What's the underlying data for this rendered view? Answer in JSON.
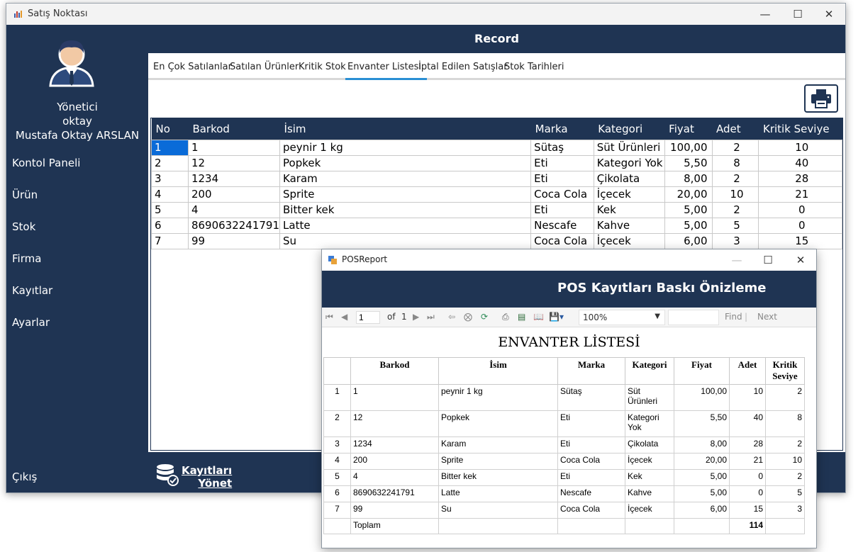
{
  "main_window": {
    "title": "Satış Noktası",
    "header": "Record"
  },
  "user": {
    "role": "Yönetici",
    "username": "oktay",
    "fullname": "Mustafa Oktay ARSLAN"
  },
  "nav": [
    {
      "label": "Kontol Paneli"
    },
    {
      "label": "Ürün"
    },
    {
      "label": "Stok"
    },
    {
      "label": "Firma"
    },
    {
      "label": "Kayıtlar"
    },
    {
      "label": "Ayarlar"
    }
  ],
  "logout": "Çıkış",
  "manage": {
    "line1": "Kayıtları",
    "line2": "Yönet"
  },
  "tabs": [
    {
      "label": "En Çok Satılanlar"
    },
    {
      "label": "Satılan Ürünler"
    },
    {
      "label": "Kritik Stok"
    },
    {
      "label": "Envanter Listesi",
      "active": true
    },
    {
      "label": "İptal Edilen Satışlar"
    },
    {
      "label": "Stok Tarihleri"
    }
  ],
  "grid": {
    "headers": [
      "No",
      "Barkod",
      "İsim",
      "Marka",
      "Kategori",
      "Fiyat",
      "Adet",
      "Kritik Seviye"
    ],
    "rows": [
      [
        "1",
        "1",
        "peynir 1 kg",
        "Sütaş",
        "Süt Ürünleri",
        "100,00",
        "2",
        "10"
      ],
      [
        "2",
        "12",
        "Popkek",
        "Eti",
        "Kategori Yok",
        "5,50",
        "8",
        "40"
      ],
      [
        "3",
        "1234",
        "Karam",
        "Eti",
        "Çikolata",
        "8,00",
        "2",
        "28"
      ],
      [
        "4",
        "200",
        "Sprite",
        "Coca Cola",
        "İçecek",
        "20,00",
        "10",
        "21"
      ],
      [
        "5",
        "4",
        "Bitter kek",
        "Eti",
        "Kek",
        "5,00",
        "2",
        "0"
      ],
      [
        "6",
        "8690632241791",
        "Latte",
        "Nescafe",
        "Kahve",
        "5,00",
        "5",
        "0"
      ],
      [
        "7",
        "99",
        "Su",
        "Coca Cola",
        "İçecek",
        "6,00",
        "3",
        "15"
      ]
    ]
  },
  "report_window": {
    "title": "POSReport",
    "header": "POS Kayıtları Baskı Önizleme",
    "toolbar": {
      "page": "1",
      "of_label": "of",
      "total_pages": "1",
      "zoom": "100%",
      "find": "Find",
      "next": "Next"
    },
    "heading": "ENVANTER LİSTESİ",
    "headers": [
      "",
      "Barkod",
      "İsim",
      "Marka",
      "Kategori",
      "Fiyat",
      "Adet",
      "Kritik Seviye"
    ],
    "rows": [
      [
        "1",
        "1",
        "peynir 1 kg",
        "Sütaş",
        "Süt Ürünleri",
        "100,00",
        "10",
        "2"
      ],
      [
        "2",
        "12",
        "Popkek",
        "Eti",
        "Kategori Yok",
        "5,50",
        "40",
        "8"
      ],
      [
        "3",
        "1234",
        "Karam",
        "Eti",
        "Çikolata",
        "8,00",
        "28",
        "2"
      ],
      [
        "4",
        "200",
        "Sprite",
        "Coca Cola",
        "İçecek",
        "20,00",
        "21",
        "10"
      ],
      [
        "5",
        "4",
        "Bitter kek",
        "Eti",
        "Kek",
        "5,00",
        "0",
        "2"
      ],
      [
        "6",
        "8690632241791",
        "Latte",
        "Nescafe",
        "Kahve",
        "5,00",
        "0",
        "5"
      ],
      [
        "7",
        "99",
        "Su",
        "Coca Cola",
        "İçecek",
        "6,00",
        "15",
        "3"
      ]
    ],
    "total_label": "Toplam",
    "total_value": "114"
  },
  "colors": {
    "navy": "#1f3453",
    "accent": "#2a8fd4",
    "selection": "#0a6bd8"
  }
}
